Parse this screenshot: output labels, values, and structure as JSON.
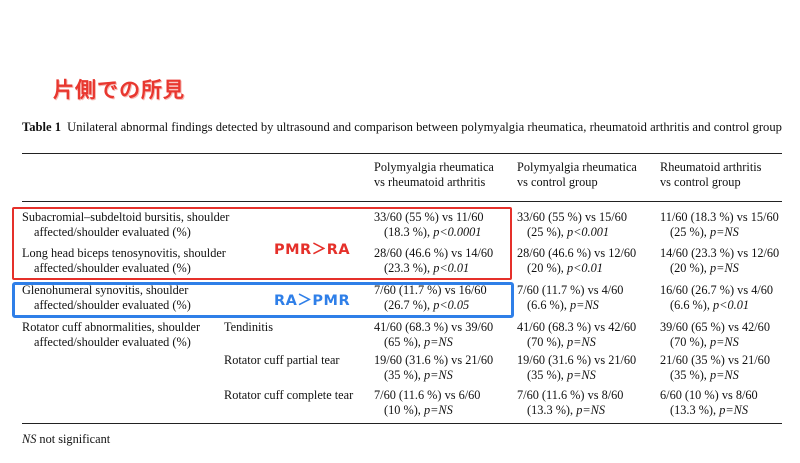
{
  "annotation": {
    "heading": "片側での所見",
    "pmr_gt_ra": "PMR＞RA",
    "ra_gt_pmr": "RA＞PMR"
  },
  "caption": {
    "label": "Table 1",
    "text": "Unilateral abnormal findings detected by ultrasound and comparison between polymyalgia rheumatica, rheumatoid arthritis and control group"
  },
  "headers": {
    "c1_l1": "Polymyalgia rheumatica",
    "c1_l2": "vs rheumatoid arthritis",
    "c2_l1": "Polymyalgia rheumatica",
    "c2_l2": "vs control group",
    "c3_l1": "Rheumatoid arthritis",
    "c3_l2": "vs control group"
  },
  "rows": [
    {
      "label_l1": "Subacromial–subdeltoid bursitis, shoulder",
      "label_l2": "affected/shoulder evaluated (%)",
      "c1_l1": "33/60 (55 %) vs 11/60",
      "c1_l2": "(18.3 %), ",
      "c1_p": "p<0.0001",
      "c2_l1": "33/60 (55 %) vs 15/60",
      "c2_l2": "(25 %), ",
      "c2_p": "p<0.001",
      "c3_l1": "11/60 (18.3 %) vs 15/60",
      "c3_l2": "(25 %), ",
      "c3_p": "p=NS"
    },
    {
      "label_l1": "Long head biceps tenosynovitis, shoulder",
      "label_l2": "affected/shoulder evaluated (%)",
      "c1_l1": "28/60 (46.6 %) vs 14/60",
      "c1_l2": "(23.3 %), ",
      "c1_p": "p<0.01",
      "c2_l1": "28/60 (46.6 %) vs 12/60",
      "c2_l2": "(20 %), ",
      "c2_p": "p<0.01",
      "c3_l1": "14/60 (23.3 %) vs 12/60",
      "c3_l2": "(20 %), ",
      "c3_p": "p=NS"
    },
    {
      "label_l1": "Glenohumeral synovitis, shoulder",
      "label_l2": "affected/shoulder evaluated (%)",
      "c1_l1": "7/60 (11.7 %) vs 16/60",
      "c1_l2": "(26.7 %), ",
      "c1_p": "p<0.05",
      "c2_l1": "7/60 (11.7 %) vs 4/60",
      "c2_l2": "(6.6 %), ",
      "c2_p": "p=NS",
      "c3_l1": "16/60 (26.7 %) vs 4/60",
      "c3_l2": "(6.6 %), ",
      "c3_p": "p<0.01"
    }
  ],
  "rotator": {
    "label_l1": "Rotator cuff abnormalities, shoulder",
    "label_l2": "affected/shoulder evaluated (%)",
    "sub": [
      {
        "name": "Tendinitis",
        "c1_l1": "41/60 (68.3 %) vs 39/60",
        "c1_l2": "(65 %), ",
        "c1_p": "p=NS",
        "c2_l1": "41/60 (68.3 %) vs 42/60",
        "c2_l2": "(70 %), ",
        "c2_p": "p=NS",
        "c3_l1": "39/60 (65 %) vs 42/60",
        "c3_l2": "(70 %), ",
        "c3_p": "p=NS"
      },
      {
        "name": "Rotator cuff partial tear",
        "c1_l1": "19/60 (31.6 %) vs 21/60",
        "c1_l2": "(35 %), ",
        "c1_p": "p=NS",
        "c2_l1": "19/60 (31.6 %) vs 21/60",
        "c2_l2": "(35 %), ",
        "c2_p": "p=NS",
        "c3_l1": "21/60 (35 %) vs 21/60",
        "c3_l2": "(35 %), ",
        "c3_p": "p=NS"
      },
      {
        "name": "Rotator cuff complete tear",
        "c1_l1": "7/60 (11.6 %) vs 6/60",
        "c1_l2": "(10 %), ",
        "c1_p": "p=NS",
        "c2_l1": "7/60 (11.6 %) vs 8/60",
        "c2_l2": "(13.3 %), ",
        "c2_p": "p=NS",
        "c3_l1": "6/60 (10 %) vs 8/60",
        "c3_l2": "(13.3 %), ",
        "c3_p": "p=NS"
      }
    ]
  },
  "footnote": {
    "abbr": "NS",
    "text": " not significant"
  },
  "colors": {
    "annotation_red": "#e5302a",
    "annotation_blue": "#2f7fe8"
  }
}
